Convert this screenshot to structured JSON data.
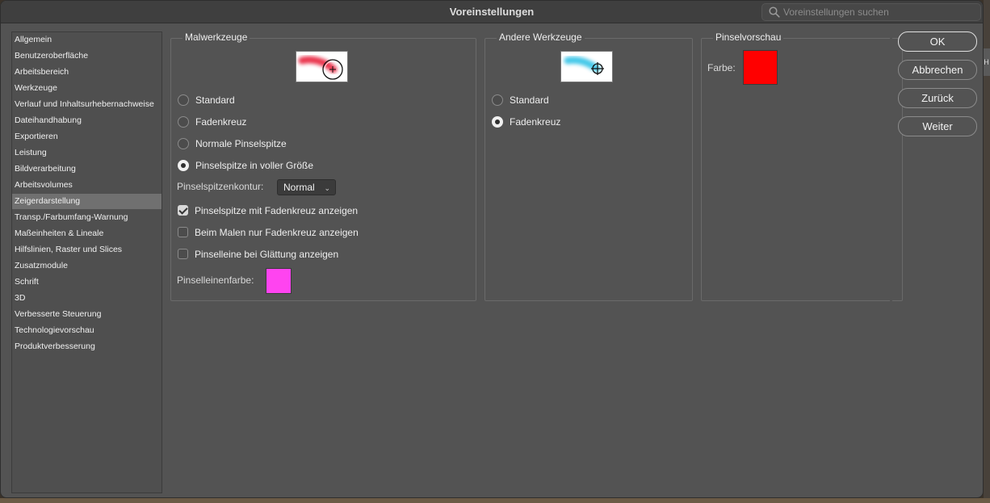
{
  "window": {
    "title": "Voreinstellungen"
  },
  "search": {
    "placeholder": "Voreinstellungen suchen"
  },
  "sidebar": {
    "items": [
      {
        "label": "Allgemein"
      },
      {
        "label": "Benutzeroberfläche"
      },
      {
        "label": "Arbeitsbereich"
      },
      {
        "label": "Werkzeuge"
      },
      {
        "label": "Verlauf und Inhaltsurhebernachweise"
      },
      {
        "label": "Dateihandhabung"
      },
      {
        "label": "Exportieren"
      },
      {
        "label": "Leistung"
      },
      {
        "label": "Bildverarbeitung"
      },
      {
        "label": "Arbeitsvolumes"
      },
      {
        "label": "Zeigerdarstellung",
        "selected": true
      },
      {
        "label": "Transp./Farbumfang-Warnung"
      },
      {
        "label": "Maßeinheiten & Lineale"
      },
      {
        "label": "Hilfslinien, Raster und Slices"
      },
      {
        "label": "Zusatzmodule"
      },
      {
        "label": "Schrift"
      },
      {
        "label": "3D"
      },
      {
        "label": "Verbesserte Steuerung"
      },
      {
        "label": "Technologievorschau"
      },
      {
        "label": "Produktverbesserung"
      }
    ]
  },
  "malwerkzeuge": {
    "title": "Malwerkzeuge",
    "options": [
      {
        "label": "Standard",
        "selected": false
      },
      {
        "label": "Fadenkreuz",
        "selected": false
      },
      {
        "label": "Normale Pinselspitze",
        "selected": false
      },
      {
        "label": "Pinselspitze in voller Größe",
        "selected": true
      }
    ],
    "kontur_label": "Pinselspitzenkontur:",
    "kontur_value": "Normal",
    "checkboxes": [
      {
        "label": "Pinselspitze mit Fadenkreuz anzeigen",
        "checked": true
      },
      {
        "label": "Beim Malen nur Fadenkreuz anzeigen",
        "checked": false
      },
      {
        "label": "Pinselleine bei Glättung anzeigen",
        "checked": false
      }
    ],
    "leinenfarbe_label": "Pinselleinenfarbe:",
    "leinenfarbe_color": "#ff44f0",
    "preview_stroke_color": "#e8203c"
  },
  "andere": {
    "title": "Andere Werkzeuge",
    "options": [
      {
        "label": "Standard",
        "selected": false
      },
      {
        "label": "Fadenkreuz",
        "selected": true
      }
    ],
    "preview_stroke_color": "#3ec6e8"
  },
  "pinselvorschau": {
    "title": "Pinselvorschau",
    "farbe_label": "Farbe:",
    "farbe_color": "#ff0000"
  },
  "buttons": {
    "ok": "OK",
    "abbrechen": "Abbrechen",
    "zurueck": "Zurück",
    "weiter": "Weiter"
  },
  "edge_tab": {
    "label": "H"
  }
}
